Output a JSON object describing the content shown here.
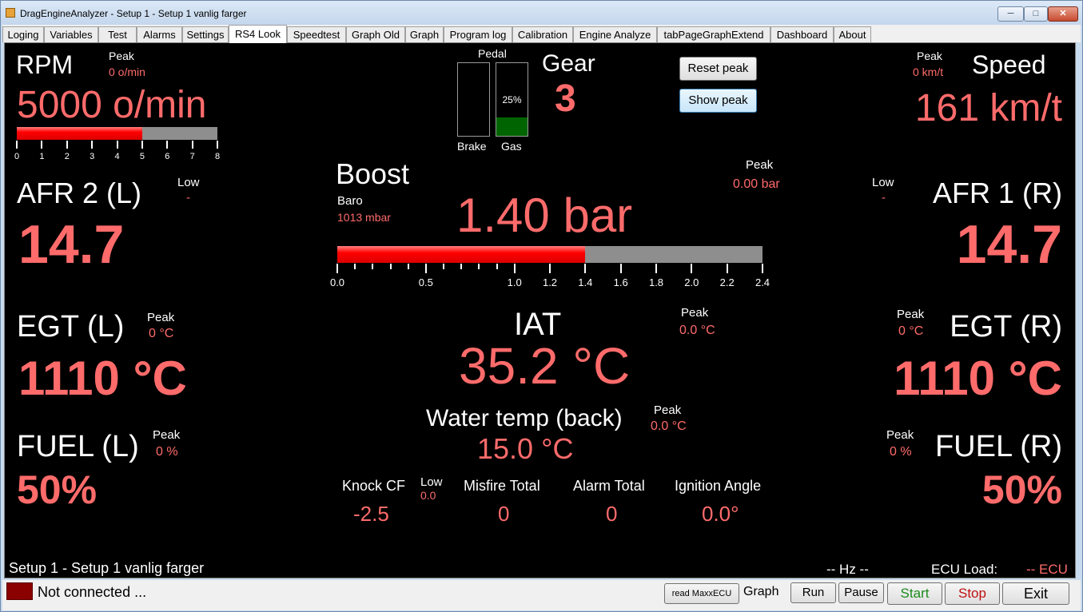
{
  "window": {
    "title": "DragEngineAnalyzer - Setup 1 - Setup 1 vanlig farger"
  },
  "tabs": [
    {
      "label": "Loging"
    },
    {
      "label": "Variables"
    },
    {
      "label": "Test"
    },
    {
      "label": "Alarms"
    },
    {
      "label": "Settings"
    },
    {
      "label": "RS4 Look",
      "active": true
    },
    {
      "label": "Speedtest"
    },
    {
      "label": "Graph Old"
    },
    {
      "label": "Graph"
    },
    {
      "label": "Program log"
    },
    {
      "label": "Calibration"
    },
    {
      "label": "Engine Analyze"
    },
    {
      "label": "tabPageGraphExtend"
    },
    {
      "label": "Dashboard"
    },
    {
      "label": "About"
    }
  ],
  "colors": {
    "value": "#ff6b6b",
    "label": "#ffffff",
    "bar_fill": "#ff0000",
    "bar_track": "#8e8e8e",
    "gas_fill": "#006400",
    "status_led": "#8b0000"
  },
  "rpm": {
    "label": "RPM",
    "peak_label": "Peak",
    "peak_value": "0 o/min",
    "value": "5000 o/min",
    "gauge": {
      "value": 5,
      "max": 8,
      "ticks": [
        "0",
        "1",
        "2",
        "3",
        "4",
        "5",
        "6",
        "7",
        "8"
      ]
    }
  },
  "pedal": {
    "label": "Pedal",
    "brake_label": "Brake",
    "gas_label": "Gas",
    "brake_percent": 0,
    "gas_percent": 25,
    "gas_text": "25%"
  },
  "gear": {
    "label": "Gear",
    "value": "3"
  },
  "buttons": {
    "reset_peak": "Reset peak",
    "show_peak": "Show peak"
  },
  "speed": {
    "label": "Speed",
    "peak_label": "Peak",
    "peak_value": "0 km/t",
    "value": "161 km/t"
  },
  "afr_left": {
    "label": "AFR  2 (L)",
    "low_label": "Low",
    "low_value": "-",
    "value": "14.7"
  },
  "afr_right": {
    "label": "AFR  1 (R)",
    "low_label": "Low",
    "low_value": "-",
    "value": "14.7"
  },
  "boost": {
    "label": "Boost",
    "baro_label": "Baro",
    "baro_value": "1013 mbar",
    "peak_label": "Peak",
    "peak_value": "0.00 bar",
    "value": "1.40 bar",
    "gauge": {
      "value": 1.4,
      "max": 2.4,
      "ticks": [
        "0.0",
        "0.5",
        "1.0",
        "1.2",
        "1.4",
        "1.6",
        "1.8",
        "2.0",
        "2.2",
        "2.4"
      ]
    }
  },
  "egt_left": {
    "label": "EGT (L)",
    "peak_label": "Peak",
    "peak_value": "0 °C",
    "value": "1110 °C"
  },
  "egt_right": {
    "label": "EGT (R)",
    "peak_label": "Peak",
    "peak_value": "0 °C",
    "value": "1110 °C"
  },
  "iat": {
    "label": "IAT",
    "peak_label": "Peak",
    "peak_value": "0.0 °C",
    "value": "35.2 °C"
  },
  "water": {
    "label": "Water temp (back)",
    "peak_label": "Peak",
    "peak_value": "0.0 °C",
    "value": "15.0 °C"
  },
  "fuel_left": {
    "label": "FUEL (L)",
    "peak_label": "Peak",
    "peak_value": "0 %",
    "value": "50%"
  },
  "fuel_right": {
    "label": "FUEL (R)",
    "peak_label": "Peak",
    "peak_value": "0 %",
    "value": "50%"
  },
  "knock": {
    "label": "Knock CF",
    "low_label": "Low",
    "low_value": "0.0",
    "value": "-2.5"
  },
  "misfire": {
    "label": "Misfire Total",
    "value": "0"
  },
  "alarm": {
    "label": "Alarm Total",
    "value": "0"
  },
  "ignition": {
    "label": "Ignition Angle",
    "value": "0.0°"
  },
  "footer": {
    "setup": "Setup 1 - Setup 1 vanlig farger",
    "hz": "-- Hz --",
    "ecu_load_label": "ECU Load:",
    "ecu_load_value": "-- ECU"
  },
  "status": {
    "connection": "Not connected ...",
    "read_button": "read MaxxECU",
    "graph_label": "Graph",
    "run": "Run",
    "pause": "Pause",
    "start": "Start",
    "stop": "Stop",
    "exit": "Exit"
  }
}
